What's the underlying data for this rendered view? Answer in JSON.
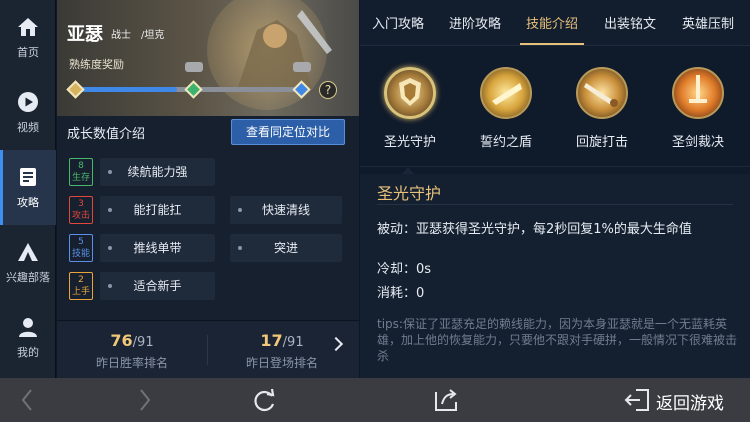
{
  "nav": {
    "items": [
      {
        "label": "首页",
        "icon": "home-icon"
      },
      {
        "label": "视频",
        "icon": "play-icon"
      },
      {
        "label": "攻略",
        "icon": "guide-icon"
      },
      {
        "label": "兴趣部落",
        "icon": "tribe-icon"
      },
      {
        "label": "我的",
        "icon": "user-icon"
      }
    ],
    "active_index": 2
  },
  "hero": {
    "name": "亚瑟",
    "role1": "战士",
    "role2": "/坦克",
    "proficiency_label": "熟练度奖励",
    "proficiency_progress": 0.45
  },
  "growth": {
    "title": "成长数值介绍",
    "compare_button": "查看同定位对比",
    "tags": [
      {
        "num": "8",
        "text": "生存",
        "color": "#49b86a"
      },
      {
        "num": "3",
        "text": "攻击",
        "color": "#e0473d"
      },
      {
        "num": "5",
        "text": "技能",
        "color": "#5b8fe8"
      },
      {
        "num": "2",
        "text": "上手",
        "color": "#e8a53d"
      }
    ],
    "traits": [
      "续航能力强",
      "能打能扛",
      "快速清线",
      "推线单带",
      "突进",
      "适合新手"
    ],
    "rank1": {
      "value": "76",
      "total": "/91",
      "label": "昨日胜率排名"
    },
    "rank2": {
      "value": "17",
      "total": "/91",
      "label": "昨日登场排名"
    }
  },
  "tabs": {
    "items": [
      "入门攻略",
      "进阶攻略",
      "技能介绍",
      "出装铭文",
      "英雄压制"
    ],
    "active_index": 2
  },
  "skills": {
    "items": [
      "圣光守护",
      "誓约之盾",
      "回旋打击",
      "圣剑裁决"
    ],
    "selected_index": 0
  },
  "detail": {
    "title": "圣光守护",
    "passive": "被动：亚瑟获得圣光守护，每2秒回复1%的最大生命值",
    "cooldown": "冷却：0s",
    "cost": "消耗：0",
    "tips": "tips:保证了亚瑟充足的赖线能力，因为本身亚瑟就是一个无蓝耗英雄，加上他的恢复能力，只要他不跟对手硬拼，一般情况下很难被击杀"
  },
  "bottom": {
    "back_game": "返回游戏"
  },
  "colors": {
    "accent_gold": "#e7c07a",
    "accent_blue": "#3f8ff0"
  }
}
